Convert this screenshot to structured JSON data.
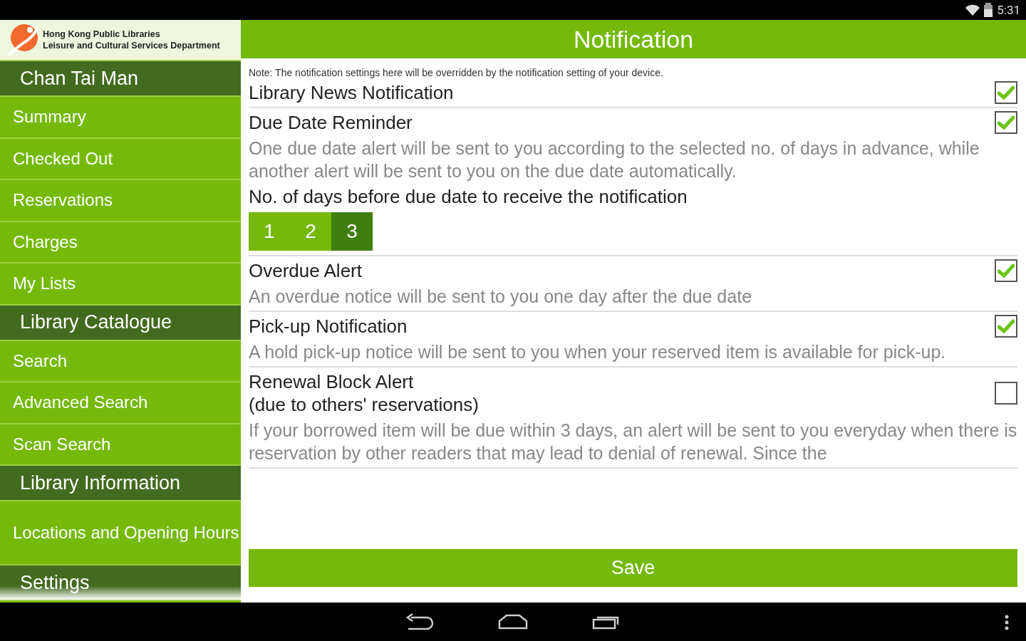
{
  "status_bar": {
    "time": "5:31"
  },
  "brand": {
    "line1": "Hong Kong Public Libraries",
    "line2": "Leisure and Cultural Services Department"
  },
  "sidebar": {
    "items": [
      {
        "kind": "header",
        "label": "Chan Tai Man"
      },
      {
        "kind": "item",
        "label": "Summary"
      },
      {
        "kind": "item",
        "label": "Checked Out"
      },
      {
        "kind": "item",
        "label": "Reservations"
      },
      {
        "kind": "item",
        "label": "Charges"
      },
      {
        "kind": "item",
        "label": "My Lists"
      },
      {
        "kind": "header",
        "label": "Library Catalogue"
      },
      {
        "kind": "item",
        "label": "Search"
      },
      {
        "kind": "item",
        "label": "Advanced Search"
      },
      {
        "kind": "item",
        "label": "Scan Search"
      },
      {
        "kind": "header",
        "label": "Library Information"
      },
      {
        "kind": "item",
        "label": "Locations and Opening Hours"
      },
      {
        "kind": "header",
        "label": "Settings"
      }
    ]
  },
  "title": "Notification",
  "note": "Note: The notification settings here will be overridden by the notification setting of your device.",
  "settings": [
    {
      "title": "Library News Notification",
      "checked": true
    },
    {
      "title": "Due Date Reminder",
      "checked": true,
      "description": "One due date alert will be sent to you according to the selected no. of days in advance, while another alert will be sent to you on the due date automatically.",
      "days_label": "No. of days before due date to receive the notification",
      "days": [
        {
          "label": "1",
          "selected": false
        },
        {
          "label": "2",
          "selected": false
        },
        {
          "label": "3",
          "selected": true
        }
      ]
    },
    {
      "title": "Overdue Alert",
      "checked": true,
      "description": "An overdue notice will be sent to you one day after the due date"
    },
    {
      "title": "Pick-up Notification",
      "checked": true,
      "description": "A hold pick-up notice will be sent to you when your reserved item is available for pick-up."
    },
    {
      "title": "Renewal Block Alert\n(due to others' reservations)",
      "checked": false,
      "description": "If your borrowed item will be due within 3 days, an alert will be sent to you everyday when there is reservation by other readers that may lead to denial of renewal. Since the"
    }
  ],
  "save_button": "Save"
}
